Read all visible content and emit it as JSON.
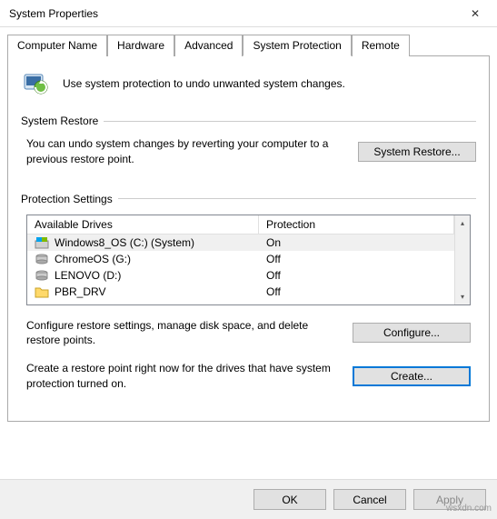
{
  "window": {
    "title": "System Properties",
    "close_glyph": "✕"
  },
  "tabs": {
    "computer_name": "Computer Name",
    "hardware": "Hardware",
    "advanced": "Advanced",
    "system_protection": "System Protection",
    "remote": "Remote"
  },
  "intro": {
    "text": "Use system protection to undo unwanted system changes."
  },
  "system_restore": {
    "legend": "System Restore",
    "description": "You can undo system changes by reverting your computer to a previous restore point.",
    "button": "System Restore..."
  },
  "protection_settings": {
    "legend": "Protection Settings",
    "columns": {
      "drives": "Available Drives",
      "protection": "Protection"
    },
    "drives": [
      {
        "name": "Windows8_OS (C:) (System)",
        "protection": "On",
        "icon": "win"
      },
      {
        "name": "ChromeOS (G:)",
        "protection": "Off",
        "icon": "hdd"
      },
      {
        "name": "LENOVO (D:)",
        "protection": "Off",
        "icon": "hdd"
      },
      {
        "name": "PBR_DRV",
        "protection": "Off",
        "icon": "folder"
      }
    ],
    "configure_text": "Configure restore settings, manage disk space, and delete restore points.",
    "configure_button": "Configure...",
    "create_text": "Create a restore point right now for the drives that have system protection turned on.",
    "create_button": "Create..."
  },
  "footer": {
    "ok": "OK",
    "cancel": "Cancel",
    "apply": "Apply"
  },
  "watermark": "wsxdn.com"
}
